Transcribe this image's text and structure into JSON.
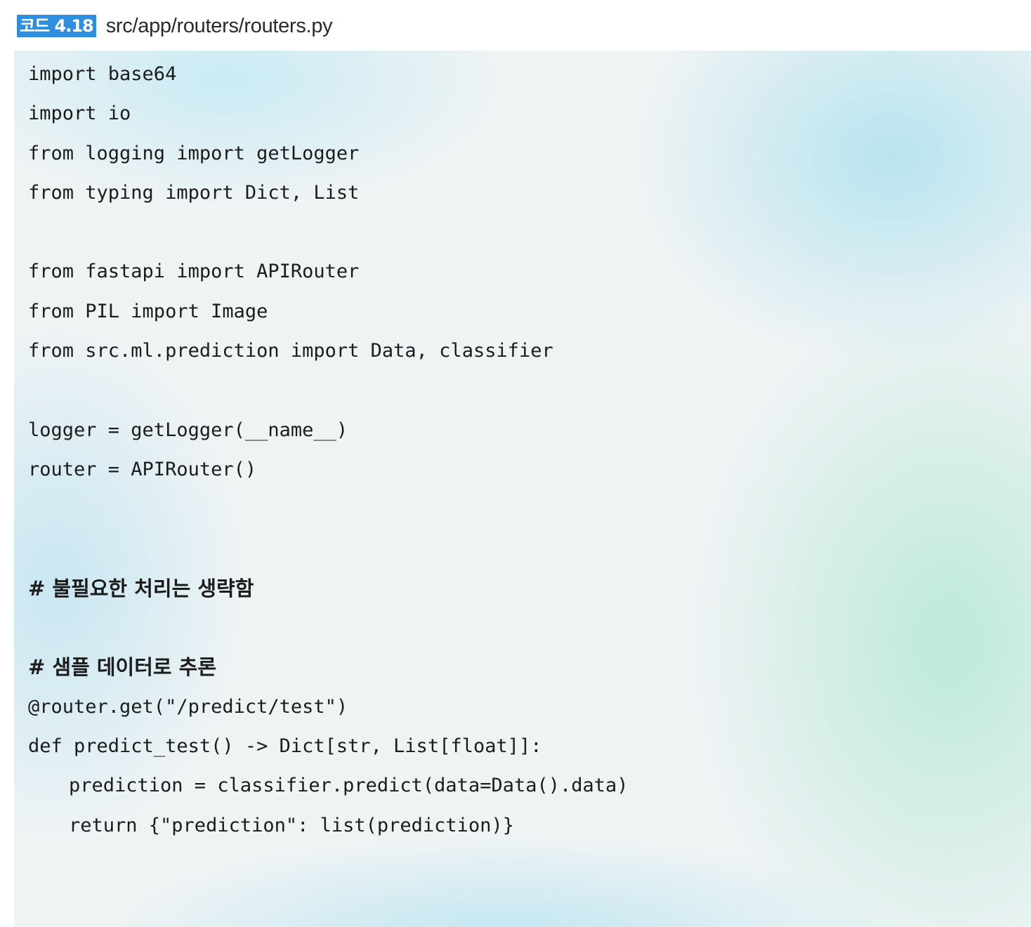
{
  "caption": {
    "badge": "코드 4.18",
    "filename": "src/app/routers/routers.py"
  },
  "code_lines": [
    "import base64",
    "import io",
    "from logging import getLogger",
    "from typing import Dict, List",
    "",
    "from fastapi import APIRouter",
    "from PIL import Image",
    "from src.ml.prediction import Data, classifier",
    "",
    "logger = getLogger(__name__)",
    "router = APIRouter()",
    "",
    "",
    "# 불필요한 처리는 생략함",
    "",
    "# 샘플 데이터로 추론",
    "@router.get(\"/predict/test\")",
    "def predict_test() -> Dict[str, List[float]]:",
    "prediction = classifier.predict(data=Data().data)",
    "return {\"prediction\": list(prediction)}"
  ]
}
